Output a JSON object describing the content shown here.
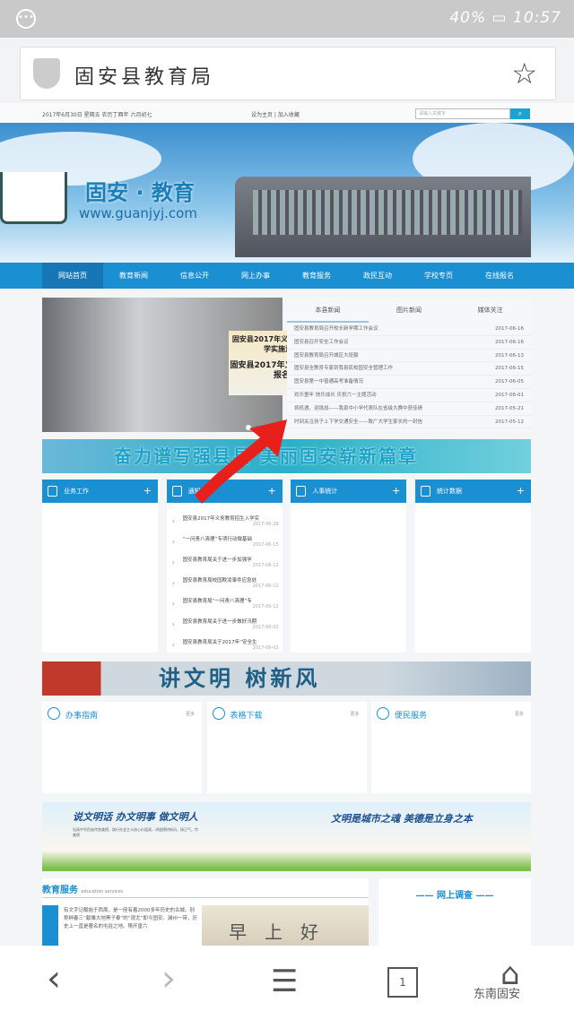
{
  "status": {
    "battery": "40%",
    "time": "10:57",
    "menu_icon": "more-dots-icon"
  },
  "address": {
    "title": "固安县教育局",
    "icon": "shield-icon",
    "star": "star-icon"
  },
  "topstrip": {
    "date": "2017年6月30日 星期五 农历丁酉年 六月初七",
    "links": "设为主页 | 加入收藏",
    "search_placeholder": "请输入关键字"
  },
  "banner": {
    "title": "固安 · 教育",
    "url": "www.guanjyj.com"
  },
  "nav": [
    "网站首页",
    "教育新闻",
    "信息公开",
    "网上办事",
    "教育服务",
    "政民互动",
    "学校专页",
    "在线报名"
  ],
  "carousel": {
    "caption1": "固安县2017年义务教育招生入学实施意见",
    "caption2": "固安县2017年义务教育在线报名"
  },
  "news": {
    "tabs": [
      "本县新闻",
      "图片新闻",
      "媒体关注"
    ],
    "items": [
      {
        "t": "固安县教育局召开校长新学期工作会议",
        "d": "2017-06-16"
      },
      {
        "t": "固安县召开安全工作会议",
        "d": "2017-06-16"
      },
      {
        "t": "固安县教育局召开城区大班额",
        "d": "2017-06-13"
      },
      {
        "t": "固安县全教育专家到我县民校园安全管理工作",
        "d": "2017-06-15"
      },
      {
        "t": "固安县第一中普通高考准备情况",
        "d": "2017-06-05"
      },
      {
        "t": "欢乐童年 快乐成长 庆祝六一主题活动",
        "d": "2017-06-01"
      },
      {
        "t": "抓机遇、迎挑战——我县中小学代表队在省级大赛中获佳绩",
        "d": "2017-05-21"
      },
      {
        "t": "时刻关注孩子上下学交通安全——致广大学生家长的一封信",
        "d": "2017-05-12"
      }
    ]
  },
  "slogan": "奋力谱写强县县 美丽固安崭新篇章",
  "boxes": [
    {
      "title": "业务工作",
      "items": []
    },
    {
      "title": "通知公告",
      "items": [
        {
          "t": "固安县2017年义务教育招生入学实",
          "d": "2017-06-28"
        },
        {
          "t": "“一问责八清理”专项行动微基础",
          "d": "2017-06-15"
        },
        {
          "t": "固安县教育局关于进一步加强学",
          "d": "2017-06-12"
        },
        {
          "t": "固安县教育局校园欺凌事件应急处",
          "d": "2017-06-12"
        },
        {
          "t": "固安县教育局“一问责八清理”专",
          "d": "2017-06-12"
        },
        {
          "t": "固安县教育局关于进一步做好汛期",
          "d": "2017-06-02"
        },
        {
          "t": "固安县教育局关于2017年“安全生",
          "d": "2017-06-02"
        }
      ]
    },
    {
      "title": "人事统计",
      "items": []
    },
    {
      "title": "统计数据",
      "items": []
    }
  ],
  "civ_banner": "讲文明  树新风",
  "services": [
    {
      "title": "办事指南",
      "more": "更多"
    },
    {
      "title": "表格下载",
      "more": "更多"
    },
    {
      "title": "便民服务",
      "more": "更多"
    }
  ],
  "walk_banner": {
    "left": "说文明话 办文明事 做文明人",
    "right": "文明是城市之魂 美德是立身之本",
    "small": "弘扬中华民族传统美德，践行社会主义核心价值观，讲道德树新风，扬正气，传美德"
  },
  "edu": {
    "title": "教育服务",
    "sub": "education services",
    "text": "有文字记载始于西周，是一座有着2000多年历史的古城。别称畔春三“献雅大地黑子泰”的“观尤”即今固安。渊州一带，历史上一直是著名的屯驻之地。隋开皇六",
    "pic": "早上好"
  },
  "survey": "网上调查",
  "watermark": "东南固安",
  "accent": "#1a8fd1"
}
